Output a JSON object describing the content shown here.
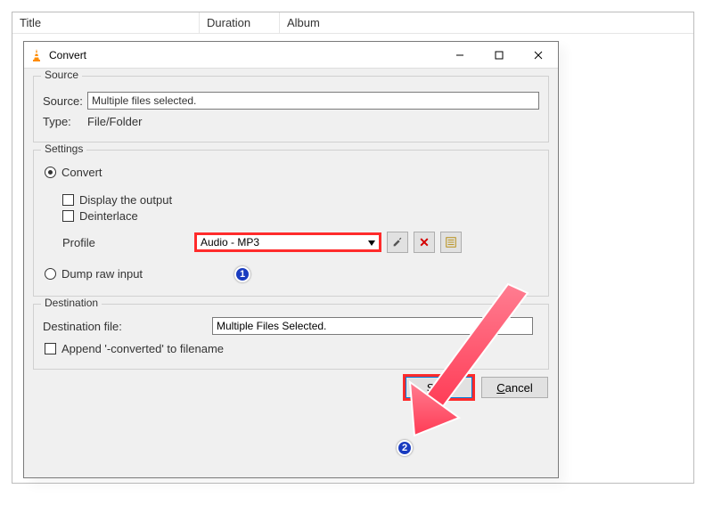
{
  "backdrop": {
    "columns": {
      "title": "Title",
      "duration": "Duration",
      "album": "Album"
    }
  },
  "dialog": {
    "title": "Convert",
    "source_group": {
      "legend": "Source",
      "source_label": "Source:",
      "source_value": "Multiple files selected.",
      "type_label": "Type:",
      "type_value": "File/Folder"
    },
    "settings_group": {
      "legend": "Settings",
      "convert_label": "Convert",
      "display_output_label": "Display the output",
      "deinterlace_label": "Deinterlace",
      "profile_label": "Profile",
      "profile_value": "Audio - MP3",
      "dump_label": "Dump raw input"
    },
    "destination_group": {
      "legend": "Destination",
      "dest_file_label": "Destination file:",
      "dest_file_value": "Multiple Files Selected.",
      "append_label": "Append '-converted' to filename"
    },
    "buttons": {
      "start": "Start",
      "cancel": "Cancel"
    }
  },
  "annotations": {
    "step1": "1",
    "step2": "2",
    "highlight_color": "#ff2b2b",
    "badge_color": "#1a3cc0"
  }
}
